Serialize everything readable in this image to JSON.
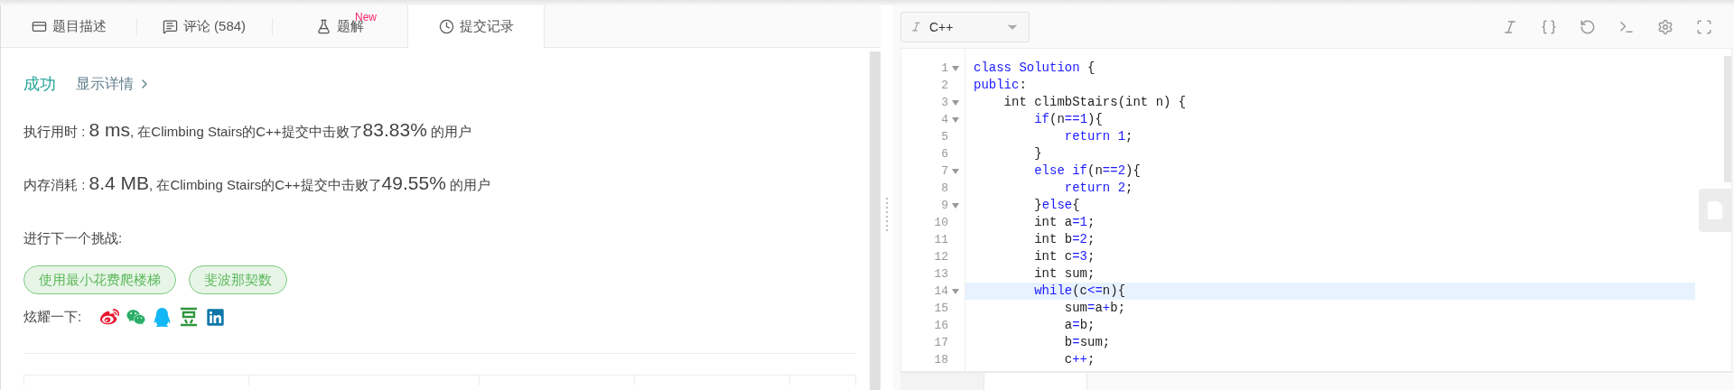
{
  "problem_tabs": [
    {
      "label": "题目描述",
      "selected": false
    },
    {
      "label": "评论 (584)",
      "selected": false
    },
    {
      "label": "题解",
      "badge": "New",
      "selected": false
    },
    {
      "label": "提交记录",
      "selected": true
    }
  ],
  "result": {
    "status": "成功",
    "details_link": "显示详情"
  },
  "stats": [
    {
      "label": "执行用时 : ",
      "value": "8 ms",
      "middle": ", 在Climbing Stairs的C++提交中击败了",
      "percent": "83.83%",
      "suffix": " 的用户"
    },
    {
      "label": "内存消耗 : ",
      "value": "8.4 MB",
      "middle": ", 在Climbing Stairs的C++提交中击败了",
      "percent": "49.55%",
      "suffix": " 的用户"
    }
  ],
  "next_challenge": {
    "label": "进行下一个挑战:",
    "items": [
      "使用最小花费爬楼梯",
      "斐波那契数"
    ]
  },
  "share": {
    "label": "炫耀一下:"
  },
  "editor": {
    "language": "C++",
    "lines": [
      {
        "number": "1",
        "fold": true,
        "active": false,
        "tokens": [
          {
            "kind": "keyword",
            "text": "class Solution"
          },
          {
            "kind": "plain",
            "text": " {"
          }
        ]
      },
      {
        "number": "2",
        "fold": false,
        "active": false,
        "tokens": [
          {
            "kind": "keyword",
            "text": "public"
          },
          {
            "kind": "plain",
            "text": ":"
          }
        ]
      },
      {
        "number": "3",
        "fold": true,
        "active": false,
        "tokens": [
          {
            "kind": "plain",
            "text": "    int climbStairs(int n) {"
          }
        ]
      },
      {
        "number": "4",
        "fold": true,
        "active": false,
        "tokens": [
          {
            "kind": "keyword",
            "text": "        if"
          },
          {
            "kind": "plain",
            "text": "(n"
          },
          {
            "kind": "keyword",
            "text": "==1"
          },
          {
            "kind": "plain",
            "text": "){"
          }
        ]
      },
      {
        "number": "5",
        "fold": false,
        "active": false,
        "tokens": [
          {
            "kind": "keyword",
            "text": "            return 1"
          },
          {
            "kind": "plain",
            "text": ";"
          }
        ]
      },
      {
        "number": "6",
        "fold": false,
        "active": false,
        "tokens": [
          {
            "kind": "plain",
            "text": "        }"
          }
        ]
      },
      {
        "number": "7",
        "fold": true,
        "active": false,
        "tokens": [
          {
            "kind": "keyword",
            "text": "        else if"
          },
          {
            "kind": "plain",
            "text": "(n"
          },
          {
            "kind": "keyword",
            "text": "==2"
          },
          {
            "kind": "plain",
            "text": "){"
          }
        ]
      },
      {
        "number": "8",
        "fold": false,
        "active": false,
        "tokens": [
          {
            "kind": "keyword",
            "text": "            return 2"
          },
          {
            "kind": "plain",
            "text": ";"
          }
        ]
      },
      {
        "number": "9",
        "fold": true,
        "active": false,
        "tokens": [
          {
            "kind": "plain",
            "text": "        }"
          },
          {
            "kind": "keyword",
            "text": "else"
          },
          {
            "kind": "plain",
            "text": "{"
          }
        ]
      },
      {
        "number": "10",
        "fold": false,
        "active": false,
        "tokens": [
          {
            "kind": "plain",
            "text": "        int a"
          },
          {
            "kind": "keyword",
            "text": "=1"
          },
          {
            "kind": "plain",
            "text": ";"
          }
        ]
      },
      {
        "number": "11",
        "fold": false,
        "active": false,
        "tokens": [
          {
            "kind": "plain",
            "text": "        int b"
          },
          {
            "kind": "keyword",
            "text": "=2"
          },
          {
            "kind": "plain",
            "text": ";"
          }
        ]
      },
      {
        "number": "12",
        "fold": false,
        "active": false,
        "tokens": [
          {
            "kind": "plain",
            "text": "        int c"
          },
          {
            "kind": "keyword",
            "text": "=3"
          },
          {
            "kind": "plain",
            "text": ";"
          }
        ]
      },
      {
        "number": "13",
        "fold": false,
        "active": false,
        "tokens": [
          {
            "kind": "plain",
            "text": "        int sum;"
          }
        ]
      },
      {
        "number": "14",
        "fold": true,
        "active": true,
        "tokens": [
          {
            "kind": "keyword",
            "text": "        while"
          },
          {
            "kind": "plain",
            "text": "(c"
          },
          {
            "kind": "keyword",
            "text": "<="
          },
          {
            "kind": "plain",
            "text": "n){"
          }
        ]
      },
      {
        "number": "15",
        "fold": false,
        "active": false,
        "tokens": [
          {
            "kind": "plain",
            "text": "            sum"
          },
          {
            "kind": "keyword",
            "text": "="
          },
          {
            "kind": "plain",
            "text": "a"
          },
          {
            "kind": "keyword",
            "text": "+"
          },
          {
            "kind": "plain",
            "text": "b;"
          }
        ]
      },
      {
        "number": "16",
        "fold": false,
        "active": false,
        "tokens": [
          {
            "kind": "plain",
            "text": "            a"
          },
          {
            "kind": "keyword",
            "text": "="
          },
          {
            "kind": "plain",
            "text": "b;"
          }
        ]
      },
      {
        "number": "17",
        "fold": false,
        "active": false,
        "tokens": [
          {
            "kind": "plain",
            "text": "            b"
          },
          {
            "kind": "keyword",
            "text": "="
          },
          {
            "kind": "plain",
            "text": "sum;"
          }
        ]
      },
      {
        "number": "18",
        "fold": false,
        "active": false,
        "tokens": [
          {
            "kind": "plain",
            "text": "            c"
          },
          {
            "kind": "keyword",
            "text": "++"
          },
          {
            "kind": "plain",
            "text": ";"
          }
        ]
      }
    ]
  }
}
